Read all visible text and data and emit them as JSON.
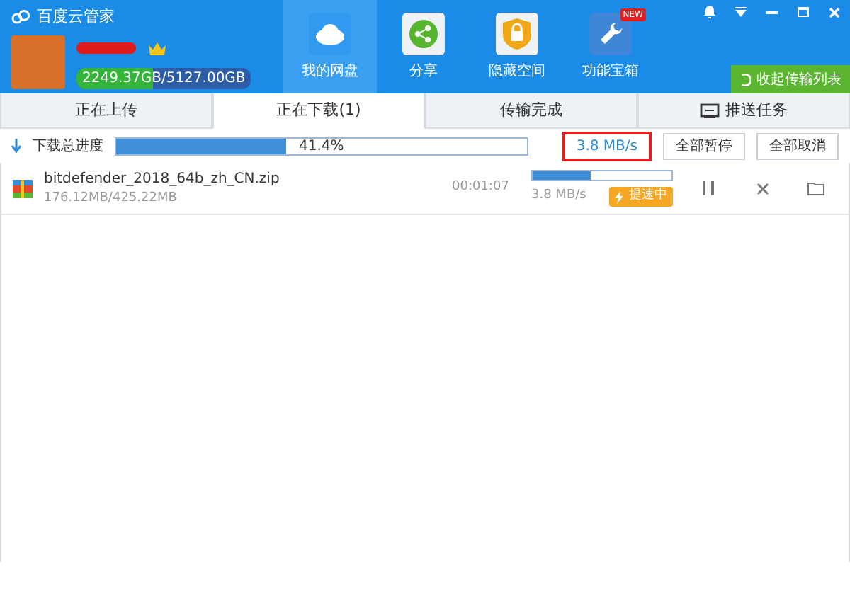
{
  "window": {
    "title": "百度云管家"
  },
  "user": {
    "quota": "2249.37GB/5127.00GB",
    "level": 0.44
  },
  "nav": [
    {
      "label": "我的网盘",
      "kind": "cloud",
      "selected": true
    },
    {
      "label": "分享",
      "kind": "share",
      "selected": false
    },
    {
      "label": "隐藏空间",
      "kind": "lock",
      "selected": false
    },
    {
      "label": "功能宝箱",
      "kind": "wrench",
      "selected": false,
      "badge": "NEW"
    }
  ],
  "collapse_button": "收起传输列表",
  "tabs": [
    {
      "label": "正在上传",
      "selected": false
    },
    {
      "label": "正在下载(1)",
      "selected": true
    },
    {
      "label": "传输完成",
      "selected": false
    },
    {
      "label": "推送任务",
      "selected": false
    }
  ],
  "total": {
    "label": "下载总进度",
    "level": 0.414,
    "percent": "41.4%",
    "speed": "3.8 MB/s",
    "buttons": [
      "全部暂停",
      "全部取消"
    ]
  },
  "downloads": [
    {
      "name": "bitdefender_2018_64b_zh_CN.zip",
      "size": "176.12MB/425.22MB",
      "time": "00:01:07",
      "level": 0.42,
      "speed": "3.8 MB/s",
      "boost": "提速中"
    }
  ]
}
